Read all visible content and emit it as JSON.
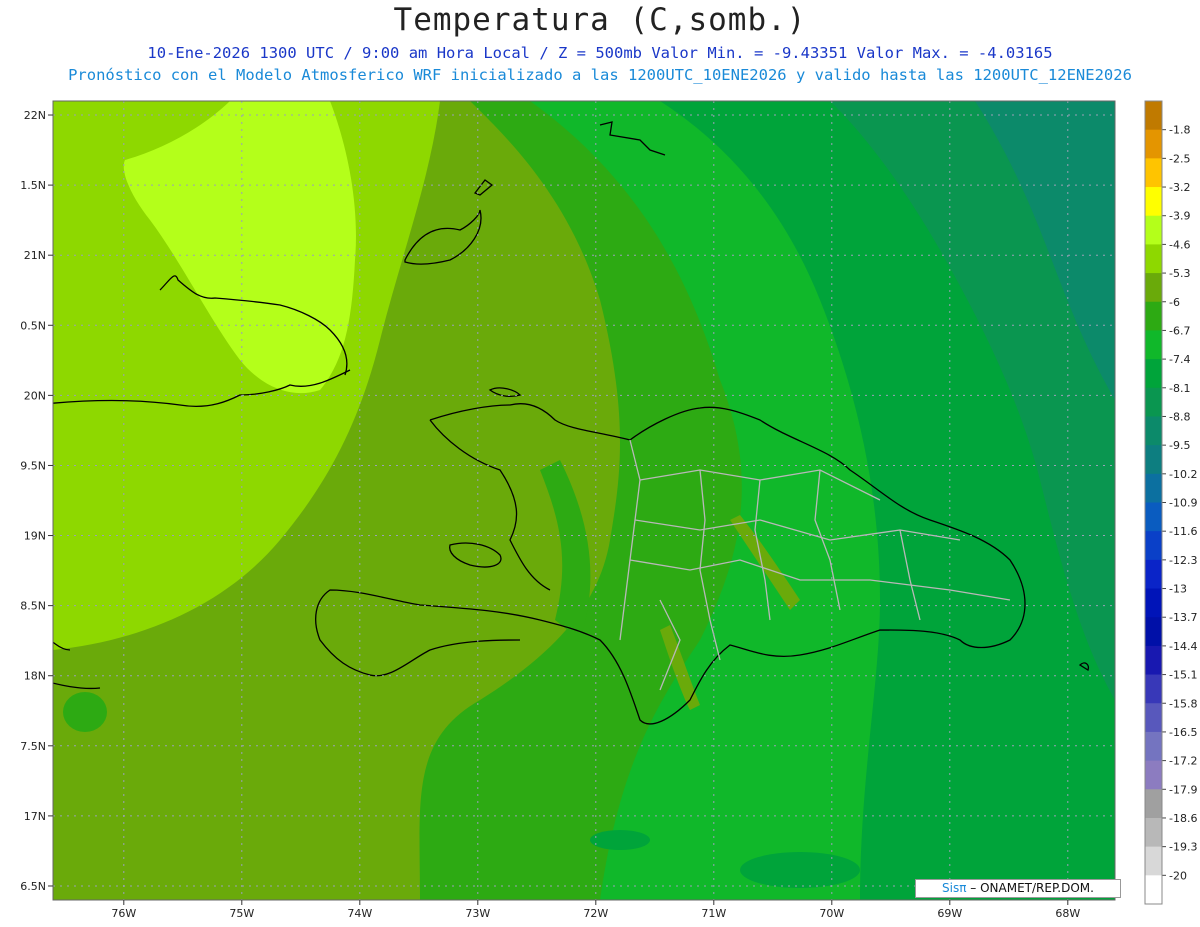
{
  "title": "Temperatura (C,somb.)",
  "subtitle_line1": "10-Ene-2026  1300 UTC / 9:00 am Hora Local / Z = 500mb  Valor Min. = -9.43351  Valor Max. = -4.03165",
  "subtitle_line2": "Pronóstico con el Modelo Atmosferico WRF inicializado a las 1200UTC_10ENE2026 y valido hasta las  1200UTC_12ENE2026",
  "credit": {
    "brand": "Sisπ",
    "text": " – ONAMET/REP.DOM."
  },
  "chart_data": {
    "type": "heatmap",
    "lon_range": [
      -76.6,
      -67.6
    ],
    "lat_range": [
      16.4,
      22.1
    ],
    "x_ticks": [
      {
        "value": -76,
        "label": "76W"
      },
      {
        "value": -75,
        "label": "75W"
      },
      {
        "value": -74,
        "label": "74W"
      },
      {
        "value": -73,
        "label": "73W"
      },
      {
        "value": -72,
        "label": "72W"
      },
      {
        "value": -71,
        "label": "71W"
      },
      {
        "value": -70,
        "label": "70W"
      },
      {
        "value": -69,
        "label": "69W"
      },
      {
        "value": -68,
        "label": "68W"
      }
    ],
    "y_ticks": [
      {
        "value": 22,
        "label": "22N"
      },
      {
        "value": 21.5,
        "label": "1.5N"
      },
      {
        "value": 21,
        "label": "21N"
      },
      {
        "value": 20.5,
        "label": "0.5N"
      },
      {
        "value": 20,
        "label": "20N"
      },
      {
        "value": 19.5,
        "label": "9.5N"
      },
      {
        "value": 19,
        "label": "19N"
      },
      {
        "value": 18.5,
        "label": "8.5N"
      },
      {
        "value": 18,
        "label": "18N"
      },
      {
        "value": 17.5,
        "label": "7.5N"
      },
      {
        "value": 17,
        "label": "17N"
      },
      {
        "value": 16.5,
        "label": "6.5N"
      }
    ],
    "grid": "dotted",
    "min_value": -9.43351,
    "max_value": -4.03165,
    "colorbar": [
      {
        "label": "-1.8",
        "color": "#c07a00"
      },
      {
        "label": "-2.5",
        "color": "#e49500"
      },
      {
        "label": "-3.2",
        "color": "#ffc400"
      },
      {
        "label": "-3.9",
        "color": "#ffff00"
      },
      {
        "label": "-4.6",
        "color": "#b4ff1a"
      },
      {
        "label": "-5.3",
        "color": "#8ed800"
      },
      {
        "label": "-6",
        "color": "#6aaa0a"
      },
      {
        "label": "-6.7",
        "color": "#2daa13"
      },
      {
        "label": "-7.4",
        "color": "#10b82a"
      },
      {
        "label": "-8.1",
        "color": "#00a43a"
      },
      {
        "label": "-8.8",
        "color": "#0a9650"
      },
      {
        "label": "-9.5",
        "color": "#0c8a6a"
      },
      {
        "label": "-10.2",
        "color": "#0d7e80"
      },
      {
        "label": "-10.9",
        "color": "#0c70a0"
      },
      {
        "label": "-11.6",
        "color": "#0a5cc0"
      },
      {
        "label": "-12.3",
        "color": "#0a40c8"
      },
      {
        "label": "-13",
        "color": "#0a24c8"
      },
      {
        "label": "-13.7",
        "color": "#0014b8"
      },
      {
        "label": "-14.4",
        "color": "#0010a8"
      },
      {
        "label": "-15.1",
        "color": "#1818b0"
      },
      {
        "label": "-15.8",
        "color": "#3838b8"
      },
      {
        "label": "-16.5",
        "color": "#5858bc"
      },
      {
        "label": "-17.2",
        "color": "#7474c0"
      },
      {
        "label": "-17.9",
        "color": "#8c7cc0"
      },
      {
        "label": "-18.6",
        "color": "#a0a0a0"
      },
      {
        "label": "-19.3",
        "color": "#b8b8b8"
      },
      {
        "label": "-20",
        "color": "#d8d8d8"
      },
      {
        "label": "",
        "color": "#ffffff"
      }
    ]
  }
}
